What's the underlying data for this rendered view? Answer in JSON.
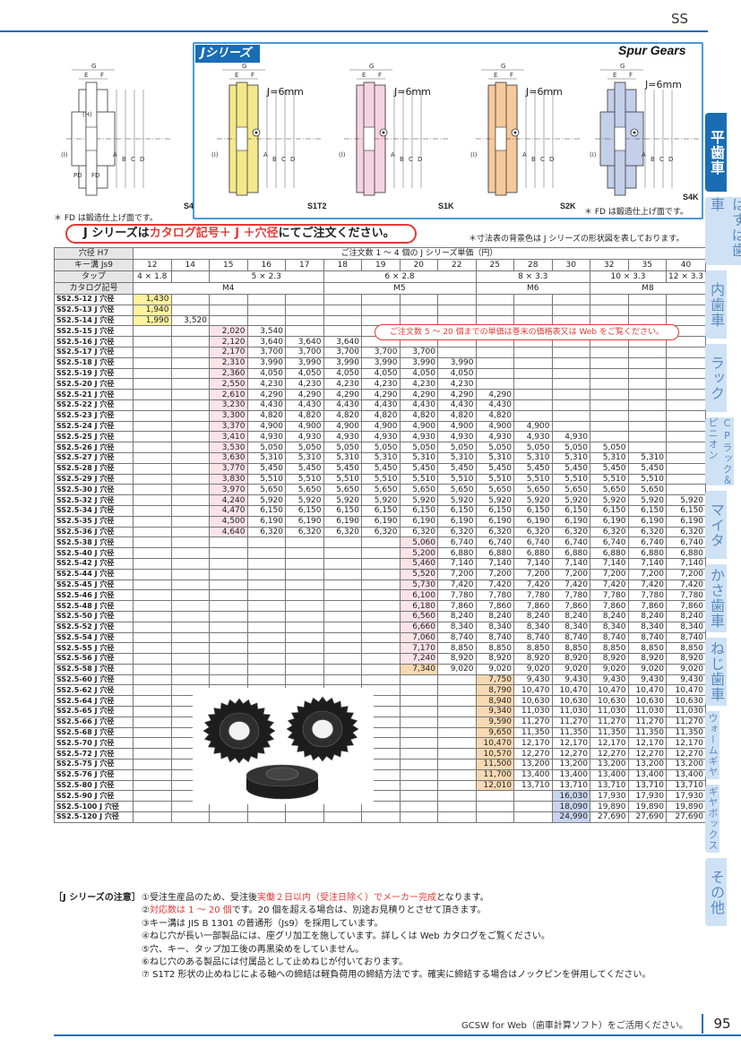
{
  "header": {
    "section": "SS",
    "subtitle": "Spur Gears"
  },
  "series_logo": "Jシリーズ",
  "drawings": [
    {
      "label": "S4",
      "color": "#fff"
    },
    {
      "label": "S1T2",
      "color": "#f5e88a"
    },
    {
      "label": "S1K",
      "color": "#f6d3e0"
    },
    {
      "label": "S2K",
      "color": "#f7c99a"
    },
    {
      "label": "S4K",
      "color": "#c4cfea"
    }
  ],
  "dim_letters": [
    "G",
    "E",
    "F",
    "A",
    "B",
    "C",
    "D",
    "(I)",
    "(H)",
    "PD",
    "FD"
  ],
  "j_note": "J=6mm",
  "fd_note": "＊ FD は鍛造仕上げ面です。",
  "order_banner": {
    "pre": "J シリーズは",
    "red": "カタログ記号＋ J ＋穴径",
    "post": "にてご注文ください。"
  },
  "bg_note": "＊寸法表の背景色は J シリーズの形状図を表しております。",
  "table": {
    "hole_label": "穴径 H7",
    "price_title": "ご注文数 1 ～ 4 個の J シリーズ単価（円）",
    "keyway_label": "キー溝 Js9",
    "tap_label": "タップ",
    "catalog_label": "カタログ記号",
    "holes": [
      "12",
      "14",
      "15",
      "16",
      "17",
      "18",
      "19",
      "20",
      "22",
      "25",
      "28",
      "30",
      "32",
      "35",
      "40"
    ],
    "keyways": [
      {
        "t": "4 × 1.8",
        "span": 1
      },
      {
        "t": "",
        "span": 1
      },
      {
        "t": "5 × 2.3",
        "span": 3
      },
      {
        "t": "6 × 2.8",
        "span": 4
      },
      {
        "t": "8 × 3.3",
        "span": 3
      },
      {
        "t": "10 × 3.3",
        "span": 2
      },
      {
        "t": "12 × 3.3",
        "span": 1
      }
    ],
    "taps": [
      {
        "t": "M4",
        "span": 5
      },
      {
        "t": "M5",
        "span": 4
      },
      {
        "t": "M6",
        "span": 3
      },
      {
        "t": "M8",
        "span": 3
      }
    ],
    "rows": [
      {
        "n": "SS2.5-12 J 穴径",
        "s": 0,
        "v": [
          "1,430"
        ]
      },
      {
        "n": "SS2.5-13 J 穴径",
        "s": 0,
        "v": [
          "1,940"
        ]
      },
      {
        "n": "SS2.5-14 J 穴径",
        "s": 0,
        "v": [
          "1,990",
          "3,520"
        ]
      },
      {
        "n": "SS2.5-15 J 穴径",
        "s": 2,
        "v": [
          "2,020",
          "3,540"
        ]
      },
      {
        "n": "SS2.5-16 J 穴径",
        "s": 2,
        "v": [
          "2,120",
          "3,640",
          "3,640",
          "3,640"
        ]
      },
      {
        "n": "SS2.5-17 J 穴径",
        "s": 2,
        "v": [
          "2,170",
          "3,700",
          "3,700",
          "3,700",
          "3,700",
          "3,700"
        ]
      },
      {
        "n": "SS2.5-18 J 穴径",
        "s": 2,
        "v": [
          "2,310",
          "3,990",
          "3,990",
          "3,990",
          "3,990",
          "3,990",
          "3,990"
        ]
      },
      {
        "n": "SS2.5-19 J 穴径",
        "s": 2,
        "v": [
          "2,360",
          "4,050",
          "4,050",
          "4,050",
          "4,050",
          "4,050",
          "4,050"
        ]
      },
      {
        "n": "SS2.5-20 J 穴径",
        "s": 2,
        "v": [
          "2,550",
          "4,230",
          "4,230",
          "4,230",
          "4,230",
          "4,230",
          "4,230"
        ]
      },
      {
        "n": "SS2.5-21 J 穴径",
        "s": 2,
        "v": [
          "2,610",
          "4,290",
          "4,290",
          "4,290",
          "4,290",
          "4,290",
          "4,290",
          "4,290"
        ]
      },
      {
        "n": "SS2.5-22 J 穴径",
        "s": 2,
        "v": [
          "3,230",
          "4,430",
          "4,430",
          "4,430",
          "4,430",
          "4,430",
          "4,430",
          "4,430"
        ]
      },
      {
        "n": "SS2.5-23 J 穴径",
        "s": 2,
        "v": [
          "3,300",
          "4,820",
          "4,820",
          "4,820",
          "4,820",
          "4,820",
          "4,820",
          "4,820"
        ]
      },
      {
        "n": "SS2.5-24 J 穴径",
        "s": 2,
        "v": [
          "3,370",
          "4,900",
          "4,900",
          "4,900",
          "4,900",
          "4,900",
          "4,900",
          "4,900",
          "4,900"
        ]
      },
      {
        "n": "SS2.5-25 J 穴径",
        "s": 2,
        "v": [
          "3,410",
          "4,930",
          "4,930",
          "4,930",
          "4,930",
          "4,930",
          "4,930",
          "4,930",
          "4,930",
          "4,930"
        ]
      },
      {
        "n": "SS2.5-26 J 穴径",
        "s": 2,
        "v": [
          "3,530",
          "5,050",
          "5,050",
          "5,050",
          "5,050",
          "5,050",
          "5,050",
          "5,050",
          "5,050",
          "5,050",
          "5,050"
        ]
      },
      {
        "n": "SS2.5-27 J 穴径",
        "s": 2,
        "v": [
          "3,630",
          "5,310",
          "5,310",
          "5,310",
          "5,310",
          "5,310",
          "5,310",
          "5,310",
          "5,310",
          "5,310",
          "5,310",
          "5,310"
        ]
      },
      {
        "n": "SS2.5-28 J 穴径",
        "s": 2,
        "v": [
          "3,770",
          "5,450",
          "5,450",
          "5,450",
          "5,450",
          "5,450",
          "5,450",
          "5,450",
          "5,450",
          "5,450",
          "5,450",
          "5,450"
        ]
      },
      {
        "n": "SS2.5-29 J 穴径",
        "s": 2,
        "v": [
          "3,830",
          "5,510",
          "5,510",
          "5,510",
          "5,510",
          "5,510",
          "5,510",
          "5,510",
          "5,510",
          "5,510",
          "5,510",
          "5,510"
        ]
      },
      {
        "n": "SS2.5-30 J 穴径",
        "s": 2,
        "v": [
          "3,970",
          "5,650",
          "5,650",
          "5,650",
          "5,650",
          "5,650",
          "5,650",
          "5,650",
          "5,650",
          "5,650",
          "5,650",
          "5,650"
        ]
      },
      {
        "n": "SS2.5-32 J 穴径",
        "s": 2,
        "v": [
          "4,240",
          "5,920",
          "5,920",
          "5,920",
          "5,920",
          "5,920",
          "5,920",
          "5,920",
          "5,920",
          "5,920",
          "5,920",
          "5,920",
          "5,920"
        ]
      },
      {
        "n": "SS2.5-34 J 穴径",
        "s": 2,
        "v": [
          "4,470",
          "6,150",
          "6,150",
          "6,150",
          "6,150",
          "6,150",
          "6,150",
          "6,150",
          "6,150",
          "6,150",
          "6,150",
          "6,150",
          "6,150"
        ]
      },
      {
        "n": "SS2.5-35 J 穴径",
        "s": 2,
        "v": [
          "4,500",
          "6,190",
          "6,190",
          "6,190",
          "6,190",
          "6,190",
          "6,190",
          "6,190",
          "6,190",
          "6,190",
          "6,190",
          "6,190",
          "6,190"
        ]
      },
      {
        "n": "SS2.5-36 J 穴径",
        "s": 2,
        "v": [
          "4,640",
          "6,320",
          "6,320",
          "6,320",
          "6,320",
          "6,320",
          "6,320",
          "6,320",
          "6,320",
          "6,320",
          "6,320",
          "6,320",
          "6,320"
        ]
      },
      {
        "n": "SS2.5-38 J 穴径",
        "s": 7,
        "v": [
          "5,060",
          "6,740",
          "6,740",
          "6,740",
          "6,740",
          "6,740",
          "6,740",
          "6,740"
        ]
      },
      {
        "n": "SS2.5-40 J 穴径",
        "s": 7,
        "v": [
          "5,200",
          "6,880",
          "6,880",
          "6,880",
          "6,880",
          "6,880",
          "6,880",
          "6,880"
        ]
      },
      {
        "n": "SS2.5-42 J 穴径",
        "s": 7,
        "v": [
          "5,460",
          "7,140",
          "7,140",
          "7,140",
          "7,140",
          "7,140",
          "7,140",
          "7,140"
        ]
      },
      {
        "n": "SS2.5-44 J 穴径",
        "s": 7,
        "v": [
          "5,520",
          "7,200",
          "7,200",
          "7,200",
          "7,200",
          "7,200",
          "7,200",
          "7,200"
        ]
      },
      {
        "n": "SS2.5-45 J 穴径",
        "s": 7,
        "v": [
          "5,730",
          "7,420",
          "7,420",
          "7,420",
          "7,420",
          "7,420",
          "7,420",
          "7,420"
        ]
      },
      {
        "n": "SS2.5-46 J 穴径",
        "s": 7,
        "v": [
          "6,100",
          "7,780",
          "7,780",
          "7,780",
          "7,780",
          "7,780",
          "7,780",
          "7,780"
        ]
      },
      {
        "n": "SS2.5-48 J 穴径",
        "s": 7,
        "v": [
          "6,180",
          "7,860",
          "7,860",
          "7,860",
          "7,860",
          "7,860",
          "7,860",
          "7,860"
        ]
      },
      {
        "n": "SS2.5-50 J 穴径",
        "s": 7,
        "v": [
          "6,560",
          "8,240",
          "8,240",
          "8,240",
          "8,240",
          "8,240",
          "8,240",
          "8,240"
        ]
      },
      {
        "n": "SS2.5-52 J 穴径",
        "s": 7,
        "v": [
          "6,660",
          "8,340",
          "8,340",
          "8,340",
          "8,340",
          "8,340",
          "8,340",
          "8,340"
        ]
      },
      {
        "n": "SS2.5-54 J 穴径",
        "s": 7,
        "v": [
          "7,060",
          "8,740",
          "8,740",
          "8,740",
          "8,740",
          "8,740",
          "8,740",
          "8,740"
        ]
      },
      {
        "n": "SS2.5-55 J 穴径",
        "s": 7,
        "v": [
          "7,170",
          "8,850",
          "8,850",
          "8,850",
          "8,850",
          "8,850",
          "8,850",
          "8,850"
        ]
      },
      {
        "n": "SS2.5-56 J 穴径",
        "s": 7,
        "v": [
          "7,240",
          "8,920",
          "8,920",
          "8,920",
          "8,920",
          "8,920",
          "8,920",
          "8,920"
        ]
      },
      {
        "n": "SS2.5-58 J 穴径",
        "s": 7,
        "v": [
          "7,340",
          "9,020",
          "9,020",
          "9,020",
          "9,020",
          "9,020",
          "9,020",
          "9,020"
        ]
      },
      {
        "n": "SS2.5-60 J 穴径",
        "s": 9,
        "v": [
          "7,750",
          "9,430",
          "9,430",
          "9,430",
          "9,430",
          "9,430"
        ]
      },
      {
        "n": "SS2.5-62 J 穴径",
        "s": 9,
        "v": [
          "8,790",
          "10,470",
          "10,470",
          "10,470",
          "10,470",
          "10,470"
        ]
      },
      {
        "n": "SS2.5-64 J 穴径",
        "s": 9,
        "v": [
          "8,940",
          "10,630",
          "10,630",
          "10,630",
          "10,630",
          "10,630"
        ]
      },
      {
        "n": "SS2.5-65 J 穴径",
        "s": 9,
        "v": [
          "9,340",
          "11,030",
          "11,030",
          "11,030",
          "11,030",
          "11,030"
        ]
      },
      {
        "n": "SS2.5-66 J 穴径",
        "s": 9,
        "v": [
          "9,590",
          "11,270",
          "11,270",
          "11,270",
          "11,270",
          "11,270"
        ]
      },
      {
        "n": "SS2.5-68 J 穴径",
        "s": 9,
        "v": [
          "9,650",
          "11,350",
          "11,350",
          "11,350",
          "11,350",
          "11,350"
        ]
      },
      {
        "n": "SS2.5-70 J 穴径",
        "s": 9,
        "v": [
          "10,470",
          "12,170",
          "12,170",
          "12,170",
          "12,170",
          "12,170"
        ]
      },
      {
        "n": "SS2.5-72 J 穴径",
        "s": 9,
        "v": [
          "10,570",
          "12,270",
          "12,270",
          "12,270",
          "12,270",
          "12,270"
        ]
      },
      {
        "n": "SS2.5-75 J 穴径",
        "s": 9,
        "v": [
          "11,500",
          "13,200",
          "13,200",
          "13,200",
          "13,200",
          "13,200"
        ]
      },
      {
        "n": "SS2.5-76 J 穴径",
        "s": 9,
        "v": [
          "11,700",
          "13,400",
          "13,400",
          "13,400",
          "13,400",
          "13,400"
        ]
      },
      {
        "n": "SS2.5-80 J 穴径",
        "s": 9,
        "v": [
          "12,010",
          "13,710",
          "13,710",
          "13,710",
          "13,710",
          "13,710"
        ]
      },
      {
        "n": "SS2.5-90 J 穴径",
        "s": 11,
        "v": [
          "16,030",
          "17,930",
          "17,930",
          "17,930"
        ]
      },
      {
        "n": "SS2.5-100 J 穴径",
        "s": 11,
        "v": [
          "18,090",
          "19,890",
          "19,890",
          "19,890"
        ]
      },
      {
        "n": "SS2.5-120 J 穴径",
        "s": 11,
        "v": [
          "24,990",
          "27,690",
          "27,690",
          "27,690"
        ]
      }
    ]
  },
  "bulk_note": "ご注文数 5 ～ 20 個までの単価は巻末の価格表又は Web をご覧ください。",
  "cautions": {
    "title": "［J シリーズの注意］",
    "items": [
      {
        "pre": "①受注生産品のため、受注後",
        "red": "実働２日以内（受注日除く）でメーカー完成",
        "post": "となります。"
      },
      {
        "pre": "②",
        "red": "対応数は 1 ～ 20 個",
        "post": "です。20 個を超える場合は、別途お見積りとさせて頂きます。"
      },
      {
        "pre": "③キー溝は JIS B 1301 の普通形（Js9）を採用しています。",
        "red": "",
        "post": ""
      },
      {
        "pre": "④ねじ穴が長い一部製品には、座グリ加工を施しています。詳しくは Web カタログをご覧ください。",
        "red": "",
        "post": ""
      },
      {
        "pre": "⑤穴、キー、タップ加工後の再黒染めをしていません。",
        "red": "",
        "post": ""
      },
      {
        "pre": "⑥ねじ穴のある製品には付属品として止めねじが付いております。",
        "red": "",
        "post": ""
      },
      {
        "pre": "⑦ S1T2 形状の止めねじによる軸への締結は軽負荷用の締結方法です。確実に締結する場合はノックピンを併用してください。",
        "red": "",
        "post": ""
      }
    ]
  },
  "side_tabs": [
    "平歯車",
    "はすば歯車",
    "内歯車",
    "ラック",
    "CPラック＆ピニオン",
    "マイタ",
    "かさ歯車",
    "ねじ歯車",
    "ウォームギヤ",
    "ギヤボックス",
    "その他"
  ],
  "footer": {
    "text": "GCSW for Web（歯車計算ソフト）をご活用ください。",
    "page": "95"
  }
}
